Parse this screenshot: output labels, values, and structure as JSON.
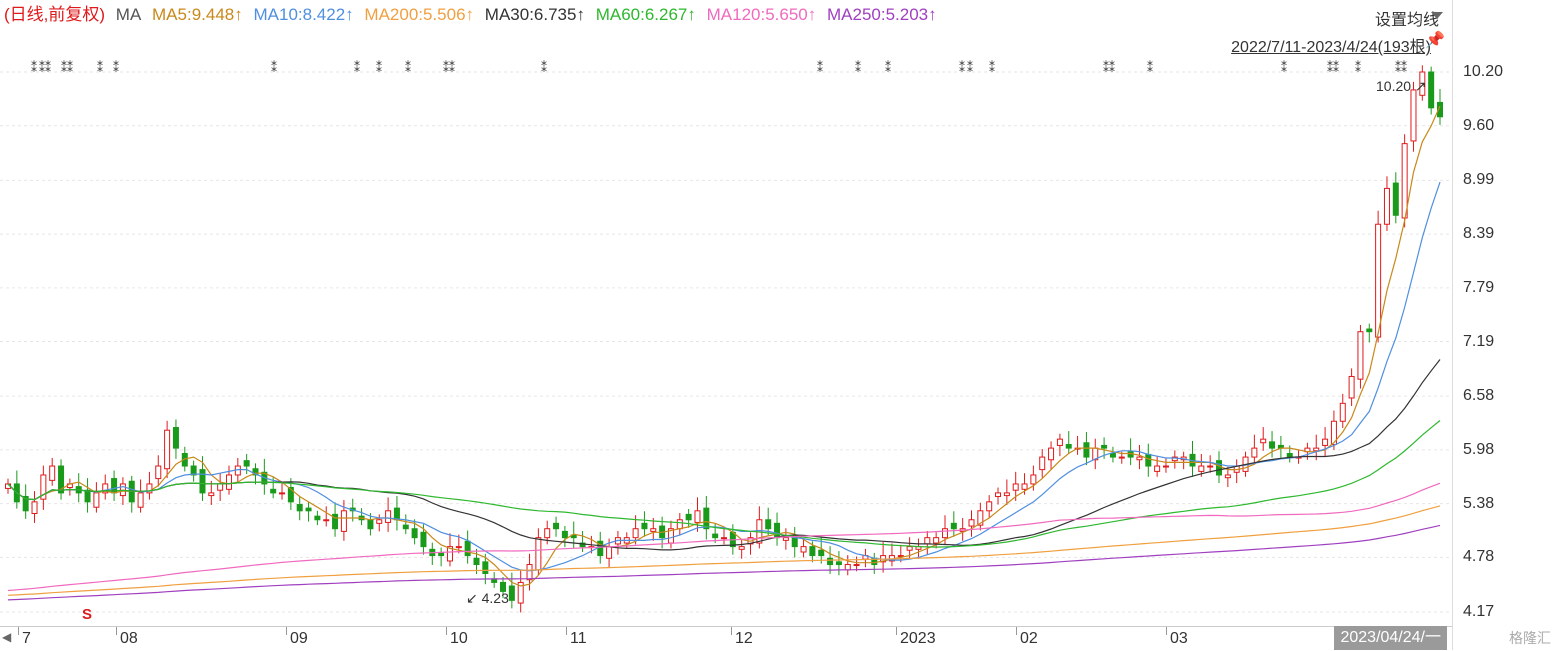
{
  "legend": {
    "period": "(日线,前复权)",
    "ma_label": "MA",
    "items": [
      {
        "text": "MA5:9.448↑",
        "color": "#c8891a"
      },
      {
        "text": "MA10:8.422↑",
        "color": "#4f8fe0"
      },
      {
        "text": "MA200:5.506↑",
        "color": "#f0a040"
      },
      {
        "text": "MA30:6.735↑",
        "color": "#333333"
      },
      {
        "text": "MA60:6.267↑",
        "color": "#2eb82e"
      },
      {
        "text": "MA120:5.650↑",
        "color": "#f06abf"
      },
      {
        "text": "MA250:5.203↑",
        "color": "#a040c0"
      }
    ]
  },
  "settings_label": "设置均线",
  "range_label": "2022/7/11-2023/4/24(193根)",
  "hi_label": "10.20",
  "lo_label": "4.23",
  "s_marker": "S",
  "date_box": "2023/04/24/一",
  "watermark": "格隆汇",
  "chart_data": {
    "type": "candlestick",
    "title": "",
    "y_ticks": [
      "10.20",
      "9.60",
      "8.99",
      "8.39",
      "7.79",
      "7.19",
      "6.58",
      "5.98",
      "5.38",
      "4.78",
      "4.17"
    ],
    "ylim": [
      4.17,
      10.2
    ],
    "x_ticks": [
      "7",
      "08",
      "09",
      "10",
      "11",
      "12",
      "2023",
      "02",
      "03"
    ],
    "ohlc_closes": [
      5.6,
      5.4,
      5.3,
      5.4,
      5.7,
      5.8,
      5.5,
      5.6,
      5.5,
      5.4,
      5.5,
      5.6,
      5.5,
      5.6,
      5.4,
      5.5,
      5.6,
      5.8,
      6.2,
      6.0,
      5.8,
      5.7,
      5.5,
      5.5,
      5.6,
      5.7,
      5.8,
      5.8,
      5.7,
      5.6,
      5.5,
      5.5,
      5.4,
      5.3,
      5.3,
      5.2,
      5.2,
      5.1,
      5.3,
      5.3,
      5.2,
      5.1,
      5.2,
      5.3,
      5.2,
      5.1,
      5.0,
      4.9,
      4.8,
      4.8,
      4.9,
      4.9,
      4.8,
      4.7,
      4.6,
      4.5,
      4.4,
      4.3,
      4.5,
      4.7,
      5.0,
      5.1,
      5.1,
      5.0,
      5.0,
      4.9,
      4.9,
      4.8,
      4.9,
      5.0,
      5.0,
      5.1,
      5.1,
      5.1,
      5.0,
      5.1,
      5.2,
      5.2,
      5.3,
      5.1,
      5.0,
      5.0,
      4.9,
      4.9,
      5.0,
      5.2,
      5.1,
      5.0,
      5.0,
      4.9,
      4.9,
      4.8,
      4.8,
      4.7,
      4.7,
      4.7,
      4.7,
      4.8,
      4.7,
      4.8,
      4.8,
      4.8,
      4.9,
      4.9,
      5.0,
      5.0,
      5.1,
      5.1,
      5.1,
      5.2,
      5.3,
      5.4,
      5.5,
      5.5,
      5.6,
      5.6,
      5.7,
      5.9,
      6.0,
      6.1,
      6.0,
      6.0,
      5.9,
      6.0,
      6.0,
      5.9,
      5.9,
      5.9,
      5.9,
      5.8,
      5.8,
      5.8,
      5.9,
      5.9,
      5.8,
      5.8,
      5.8,
      5.7,
      5.7,
      5.8,
      5.9,
      6.0,
      6.1,
      6.0,
      6.0,
      5.9,
      5.9,
      6.0,
      6.0,
      6.1,
      6.3,
      6.5,
      6.8,
      7.3,
      7.3,
      8.5,
      8.9,
      8.6,
      9.4,
      10.0,
      10.2,
      9.8,
      9.7
    ],
    "series": [
      {
        "name": "MA5",
        "color": "#c8891a"
      },
      {
        "name": "MA10",
        "color": "#4f8fe0"
      },
      {
        "name": "MA30",
        "color": "#333333"
      },
      {
        "name": "MA60",
        "color": "#2eb82e"
      },
      {
        "name": "MA120",
        "color": "#f06abf"
      },
      {
        "name": "MA200",
        "color": "#f0a040"
      },
      {
        "name": "MA250",
        "color": "#a040c0"
      }
    ],
    "up_color": "#e0191b",
    "down_color": "#1a9a1a",
    "grid": true
  }
}
